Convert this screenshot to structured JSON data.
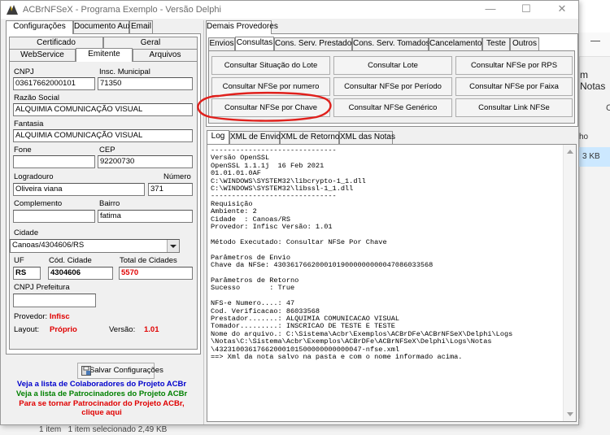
{
  "window": {
    "title": "ACBrNFSeX - Programa Exemplo - Versão Delphi"
  },
  "left_tabs": [
    "Configurações",
    "Documento Auxiliar",
    "Email"
  ],
  "left_subtabs_row1": [
    "Certificado",
    "Geral"
  ],
  "left_subtabs_row2": [
    "WebService",
    "Emitente",
    "Arquivos"
  ],
  "emitente": {
    "cnpj_label": "CNPJ",
    "cnpj": "03617662000101",
    "ie_label": "Insc. Municipal",
    "ie": "71350",
    "razao_label": "Razão Social",
    "razao": "ALQUIMIA COMUNICAÇÃO VISUAL",
    "fantasia_label": "Fantasia",
    "fantasia": "ALQUIMIA COMUNICAÇÃO VISUAL",
    "fone_label": "Fone",
    "fone": "",
    "cep_label": "CEP",
    "cep": "92200730",
    "logradouro_label": "Logradouro",
    "logradouro": "Oliveira viana",
    "numero_label": "Número",
    "numero": "371",
    "complemento_label": "Complemento",
    "complemento": "",
    "bairro_label": "Bairro",
    "bairro": "fatima",
    "cidade_label": "Cidade",
    "cidade": "Canoas/4304606/RS",
    "uf_label": "UF",
    "uf": "RS",
    "cod_cidade_label": "Cód. Cidade",
    "cod_cidade": "4304606",
    "total_label": "Total de Cidades",
    "total": "5570",
    "cnpj_pref_label": "CNPJ Prefeitura",
    "cnpj_pref": "",
    "provedor_label": "Provedor:",
    "provedor": "Infisc",
    "layout_label": "Layout:",
    "layout": "Próprio",
    "versao_label": "Versão:",
    "versao": "1.01"
  },
  "save_button": "Salvar Configurações",
  "links": {
    "colaboradores": "Veja a lista de Colaboradores do Projeto ACBr",
    "patrocinadores": "Veja a lista de Patrocinadores do Projeto ACBr",
    "patrocinar1": "Para se tornar Patrocinador do Projeto ACBr,",
    "patrocinar2": "clique aqui"
  },
  "right_top_tab": "Demais Provedores",
  "right_tabs": [
    "Envios",
    "Consultas",
    "Cons. Serv. Prestados",
    "Cons. Serv. Tomados",
    "Cancelamento",
    "Teste",
    "Outros"
  ],
  "consulta_buttons": [
    "Consultar Situação do Lote",
    "Consultar Lote",
    "Consultar NFSe por RPS",
    "Consultar NFSe por numero",
    "Consultar NFSe por Período",
    "Consultar NFSe por Faixa",
    "Consultar NFSe por Chave",
    "Consultar NFSe Genérico",
    "Consultar Link NFSe"
  ],
  "log_tabs": [
    "Log",
    "XML de Envio",
    "XML de Retorno",
    "XML das Notas"
  ],
  "log_text": "------------------------------\nVersão OpenSSL\nOpenSSL 1.1.1j  16 Feb 2021\n01.01.01.0AF\nC:\\WINDOWS\\SYSTEM32\\libcrypto-1_1.dll\nC:\\WINDOWS\\SYSTEM32\\libssl-1_1.dll\n------------------------------\nRequisição\nAmbiente: 2\nCidade  : Canoas/RS\nProvedor: Infisc Versão: 1.01\n\nMétodo Executado: Consultar NFSe Por Chave\n\nParâmetros de Envio\nChave da NFSe: 43036176620001019000000000047086033568\n\nParâmetros de Retorno\nSucesso       : True\n\nNFS-e Numero....: 47\nCod. Verificacao: 86033568\nPrestador.......: ALQUIMIA COMUNICACAO VISUAL\nTomador.........: INSCRICAO DE TESTE E TESTE\nNome do arquivo.: C:\\Sistema\\Acbr\\Exemplos\\ACBrDFe\\ACBrNFSeX\\Delphi\\Logs\n\\Notas\\C:\\Sistema\\Acbr\\Exemplos\\ACBrDFe\\ACBrNFSeX\\Delphi\\Logs\\Notas\n\\43231003617662000101500000000000047-nfse.xml\n==> Xml da nota salvo na pasta e com o nome informado acima.",
  "background": {
    "notas": "m Notas",
    "c": "C",
    "ho": "ho",
    "size": "3 KB",
    "status_items": "1 item",
    "status_sel": "1 item selecionado  2,49 KB"
  },
  "colors": {
    "highlight_circle": "#e0201c",
    "accent_red": "#e00000"
  }
}
